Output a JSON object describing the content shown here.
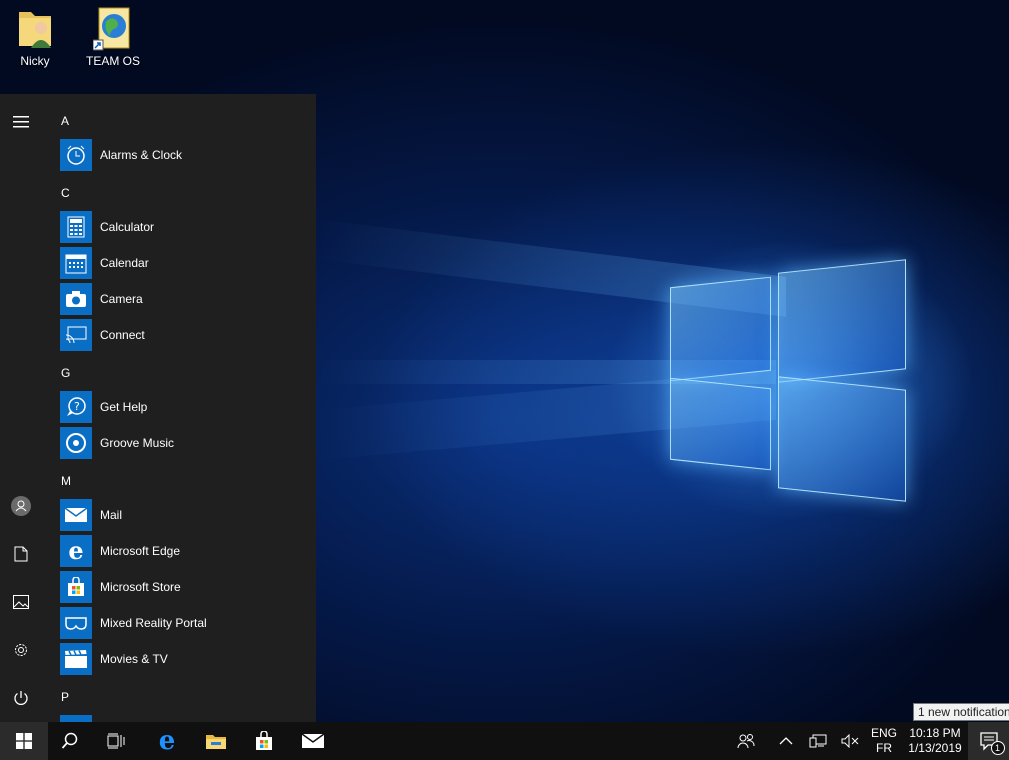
{
  "desktop": {
    "icons": [
      {
        "label": "Nicky",
        "icon": "user-folder-icon"
      },
      {
        "label": "TEAM OS",
        "icon": "globe-shortcut-icon"
      }
    ]
  },
  "start_menu": {
    "rail": [
      "hamburger-icon",
      "user-avatar-icon",
      "documents-icon",
      "pictures-icon",
      "settings-icon",
      "power-icon"
    ],
    "groups": [
      {
        "letter": "A",
        "apps": [
          {
            "label": "Alarms & Clock",
            "icon": "alarm-clock-icon"
          }
        ]
      },
      {
        "letter": "C",
        "apps": [
          {
            "label": "Calculator",
            "icon": "calculator-icon"
          },
          {
            "label": "Calendar",
            "icon": "calendar-icon"
          },
          {
            "label": "Camera",
            "icon": "camera-icon"
          },
          {
            "label": "Connect",
            "icon": "connect-icon"
          }
        ]
      },
      {
        "letter": "G",
        "apps": [
          {
            "label": "Get Help",
            "icon": "get-help-icon"
          },
          {
            "label": "Groove Music",
            "icon": "groove-music-icon"
          }
        ]
      },
      {
        "letter": "M",
        "apps": [
          {
            "label": "Mail",
            "icon": "mail-icon"
          },
          {
            "label": "Microsoft Edge",
            "icon": "edge-icon"
          },
          {
            "label": "Microsoft Store",
            "icon": "store-icon"
          },
          {
            "label": "Mixed Reality Portal",
            "icon": "mixed-reality-icon"
          },
          {
            "label": "Movies & TV",
            "icon": "movies-tv-icon"
          }
        ]
      },
      {
        "letter": "P",
        "apps": []
      }
    ]
  },
  "taskbar": {
    "pinned": [
      "start-icon",
      "search-icon",
      "task-view-icon",
      "edge-icon",
      "file-explorer-icon",
      "store-icon",
      "mail-icon"
    ],
    "tray": {
      "language_top": "ENG",
      "language_bottom": "FR",
      "time": "10:18 PM",
      "date": "1/13/2019",
      "notification_count": "1",
      "tooltip": "1 new notification"
    }
  },
  "colors": {
    "accent": "#0a6fc4",
    "start_bg": "#1f1f1f",
    "taskbar_bg": "#101010"
  }
}
